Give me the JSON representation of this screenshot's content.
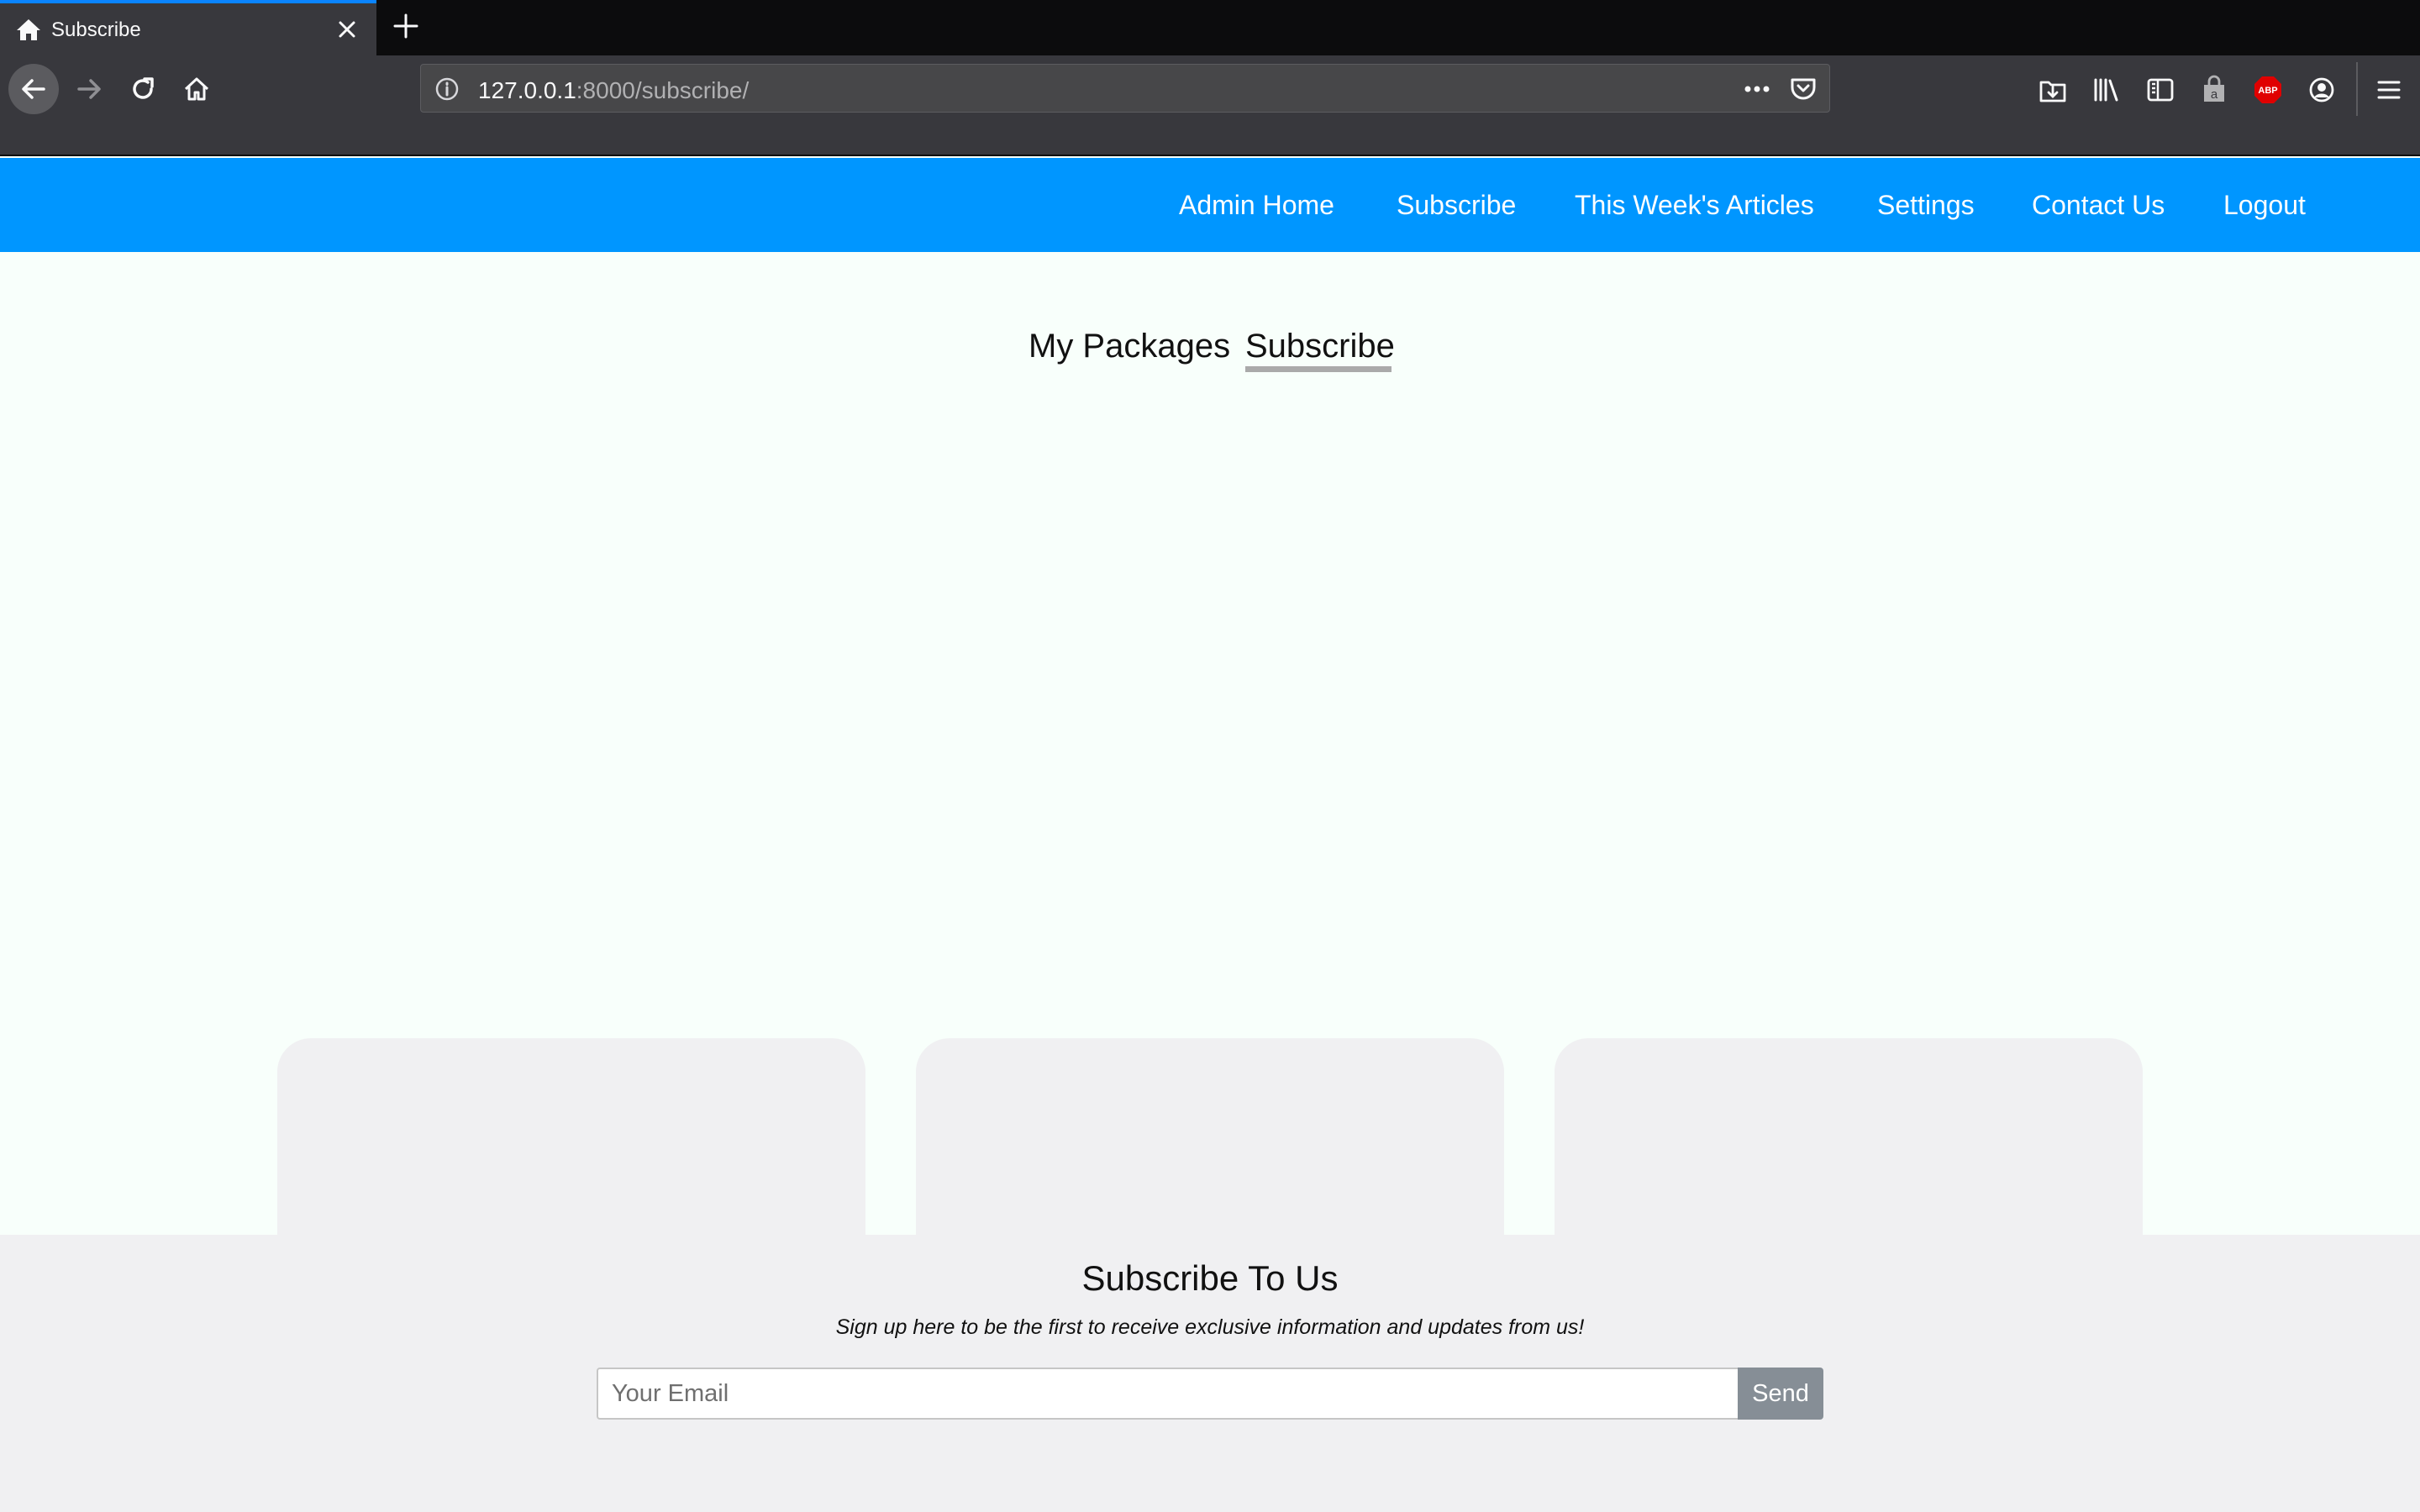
{
  "browser": {
    "tab": {
      "title": "Subscribe"
    },
    "url": {
      "host": "127.0.0.1",
      "rest": ":8000/subscribe/"
    },
    "toolbar_icons": [
      "downloads-icon",
      "library-icon",
      "sidebar-icon",
      "amazon-icon",
      "adblock-plus-icon",
      "account-icon",
      "menu-icon"
    ],
    "abp_label": "ABP",
    "accent": "#0a84ff"
  },
  "site": {
    "nav_color": "#0096ff",
    "nav": [
      {
        "label": "Admin Home"
      },
      {
        "label": "Subscribe"
      },
      {
        "label": "This Week's Articles"
      },
      {
        "label": "Settings"
      },
      {
        "label": "Contact Us"
      },
      {
        "label": "Logout"
      }
    ],
    "subtabs": [
      {
        "label": "My Packages",
        "active": false
      },
      {
        "label": "Subscribe",
        "active": true
      }
    ]
  },
  "footer": {
    "title": "Subscribe To Us",
    "subtitle": "Sign up here to be the first to receive exclusive information and updates from us!",
    "email_placeholder": "Your Email",
    "send_label": "Send"
  }
}
